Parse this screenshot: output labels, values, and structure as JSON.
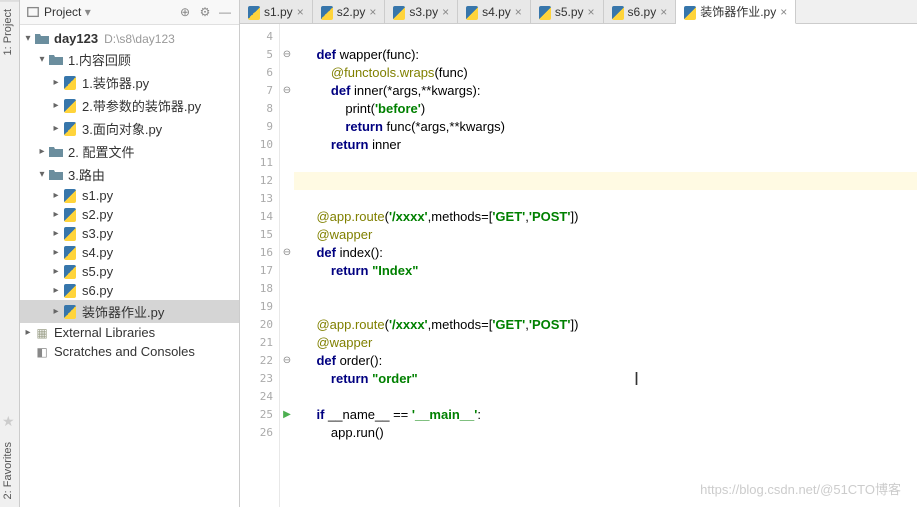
{
  "leftGutter": {
    "project": "1: Project",
    "favorites": "2: Favorites"
  },
  "sidebar": {
    "title": "Project",
    "root": {
      "label": "day123",
      "path": "D:\\s8\\day123"
    },
    "folder1": {
      "label": "1.内容回顾"
    },
    "folder1_files": [
      {
        "label": "1.装饰器.py"
      },
      {
        "label": "2.带参数的装饰器.py"
      },
      {
        "label": "3.面向对象.py"
      }
    ],
    "folder2": {
      "label": "2. 配置文件"
    },
    "folder3": {
      "label": "3.路由"
    },
    "folder3_files": [
      {
        "label": "s1.py"
      },
      {
        "label": "s2.py"
      },
      {
        "label": "s3.py"
      },
      {
        "label": "s4.py"
      },
      {
        "label": "s5.py"
      },
      {
        "label": "s6.py"
      },
      {
        "label": "装饰器作业.py"
      }
    ],
    "externalLibs": "External Libraries",
    "scratches": "Scratches and Consoles"
  },
  "tabs": [
    {
      "label": "s1.py"
    },
    {
      "label": "s2.py"
    },
    {
      "label": "s3.py"
    },
    {
      "label": "s4.py"
    },
    {
      "label": "s5.py"
    },
    {
      "label": "s6.py"
    },
    {
      "label": "装饰器作业.py",
      "active": true
    }
  ],
  "lineStart": 4,
  "lineEnd": 26,
  "code": {
    "l5": {
      "indent": "    ",
      "kw1": "def",
      "fn": " wapper(func):"
    },
    "l6": {
      "indent": "        ",
      "dec": "@functools.wraps",
      "rest": "(func)"
    },
    "l7": {
      "indent": "        ",
      "kw1": "def",
      "fn": " inner(*args,**kwargs):"
    },
    "l8": {
      "indent": "            ",
      "fn": "print(",
      "str": "'before'",
      "rest": ")"
    },
    "l9": {
      "indent": "            ",
      "kw1": "return",
      "rest": " func(*args,**kwargs)"
    },
    "l10": {
      "indent": "        ",
      "kw1": "return",
      "rest": " inner"
    },
    "l14": {
      "indent": "    ",
      "dec": "@app.route",
      "rest1": "(",
      "str1": "'/xxxx'",
      "rest2": ",methods=[",
      "str2": "'GET'",
      "rest3": ",",
      "str3": "'POST'",
      "rest4": "])"
    },
    "l15": {
      "indent": "    ",
      "dec": "@wapper"
    },
    "l16": {
      "indent": "    ",
      "kw1": "def",
      "fn": " index():"
    },
    "l17": {
      "indent": "        ",
      "kw1": "return",
      "rest": " ",
      "str": "\"Index\""
    },
    "l20": {
      "indent": "    ",
      "dec": "@app.route",
      "rest1": "(",
      "str1": "'/xxxx'",
      "rest2": ",methods=[",
      "str2": "'GET'",
      "rest3": ",",
      "str3": "'POST'",
      "rest4": "])"
    },
    "l21": {
      "indent": "    ",
      "dec": "@wapper"
    },
    "l22": {
      "indent": "    ",
      "kw1": "def",
      "fn": " order():"
    },
    "l23": {
      "indent": "        ",
      "kw1": "return",
      "rest": " ",
      "str": "\"order\""
    },
    "l25": {
      "indent": "    ",
      "kw1": "if",
      "rest1": " __name__ == ",
      "str": "'__main__'",
      "rest2": ":"
    },
    "l26": {
      "indent": "        ",
      "rest": "app.run()"
    }
  },
  "watermark": "https://blog.csdn.net/@51CTO博客"
}
